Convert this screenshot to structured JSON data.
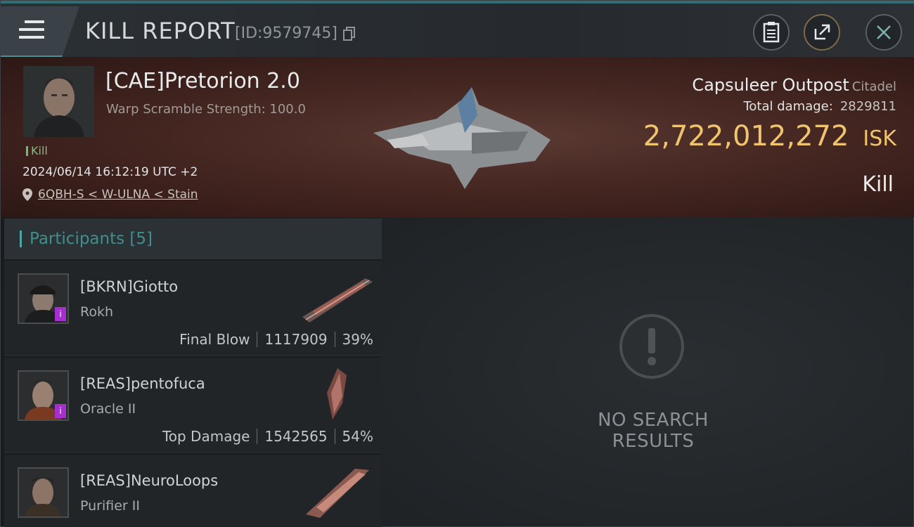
{
  "header": {
    "title": "KILL REPORT",
    "report_id": "[ID:9579745]"
  },
  "victim": {
    "name": "[CAE]Pretorion 2.0",
    "subtitle": "Warp Scramble Strength: 100.0",
    "tag": "Kill",
    "timestamp": "2024/06/14 16:12:19 UTC +2",
    "location": "6QBH-S < W-ULNA < Stain",
    "ship_name": "Capsuleer Outpost",
    "ship_type": "Citadel",
    "damage_label": "Total damage:",
    "damage_value": "2829811",
    "isk_value": "2,722,012,272",
    "isk_unit": "ISK",
    "outcome": "Kill"
  },
  "participants": {
    "label": "Participants [5]",
    "rows": [
      {
        "name": "[BKRN]Giotto",
        "ship": "Rokh",
        "role": "Final Blow",
        "damage": "1117909",
        "percent": "39%"
      },
      {
        "name": "[REAS]pentofuca",
        "ship": "Oracle II",
        "role": "Top Damage",
        "damage": "1542565",
        "percent": "54%"
      },
      {
        "name": "[REAS]NeuroLoops",
        "ship": "Purifier II",
        "role": "",
        "damage": "",
        "percent": ""
      }
    ]
  },
  "empty_state": {
    "text": "NO SEARCH RESULTS"
  },
  "colors": {
    "accent_teal": "#4fa7a3",
    "isk_gold": "#f0c36e",
    "badge_purple": "#a62fd0"
  }
}
